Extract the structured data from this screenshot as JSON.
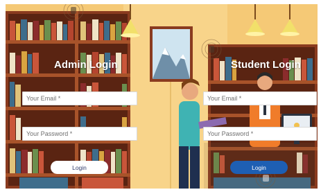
{
  "admin_panel": {
    "title": "Admin Login",
    "email_placeholder": "Your Email *",
    "password_placeholder": "Your Password *",
    "login_label": "Login"
  },
  "student_panel": {
    "title": "Student Login",
    "email_placeholder": "Your Email *",
    "password_placeholder": "Your Password *",
    "login_label": "Login"
  },
  "colors": {
    "wall": "#f5c976",
    "student_button": "#1e5fb3",
    "admin_button": "#ffffff"
  },
  "icons": [
    "lamp-icon",
    "wifi-sensor-icon",
    "mountain-painting"
  ]
}
